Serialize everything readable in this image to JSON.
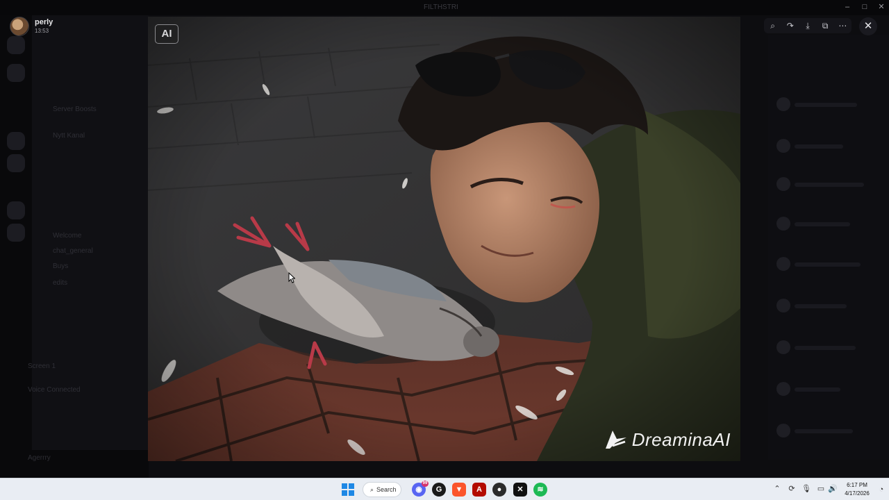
{
  "window": {
    "title": "FILTHSTRI",
    "controls": [
      "minimize",
      "maximize",
      "close"
    ]
  },
  "background": {
    "channels": [
      "Server Boosts",
      "Nytt Kanal",
      "Welcome",
      "chat_general",
      "Buys",
      "edits",
      "Voice Connected",
      "Screen 1"
    ],
    "user": "Agerrry"
  },
  "viewer": {
    "author": "perly",
    "time": "13:53",
    "ai_badge": "AI",
    "watermark": "DreaminaAI",
    "toolbar": [
      {
        "name": "zoom-icon",
        "glyph": "⌕"
      },
      {
        "name": "share-icon",
        "glyph": "↷"
      },
      {
        "name": "download-icon",
        "glyph": "⤓"
      },
      {
        "name": "open-external-icon",
        "glyph": "⧉"
      },
      {
        "name": "more-icon",
        "glyph": "⋯"
      }
    ],
    "close_glyph": "✕"
  },
  "taskbar": {
    "search_label": "Search",
    "apps": [
      {
        "name": "discord-app",
        "glyph": "◉",
        "color": "#5865f2",
        "badge": "99"
      },
      {
        "name": "g-app",
        "glyph": "G",
        "color": "#1a1a1a"
      },
      {
        "name": "brave-app",
        "glyph": "▼",
        "color": "#fb542b"
      },
      {
        "name": "acrobat-app",
        "glyph": "A",
        "color": "#b30b00"
      },
      {
        "name": "obs-app",
        "glyph": "●",
        "color": "#2b2b2b"
      },
      {
        "name": "capcut-app",
        "glyph": "✕",
        "color": "#111111"
      },
      {
        "name": "spotify-app",
        "glyph": "≋",
        "color": "#1db954"
      }
    ],
    "clock_time": "6:17 PM",
    "clock_date": "4/17/2026"
  }
}
